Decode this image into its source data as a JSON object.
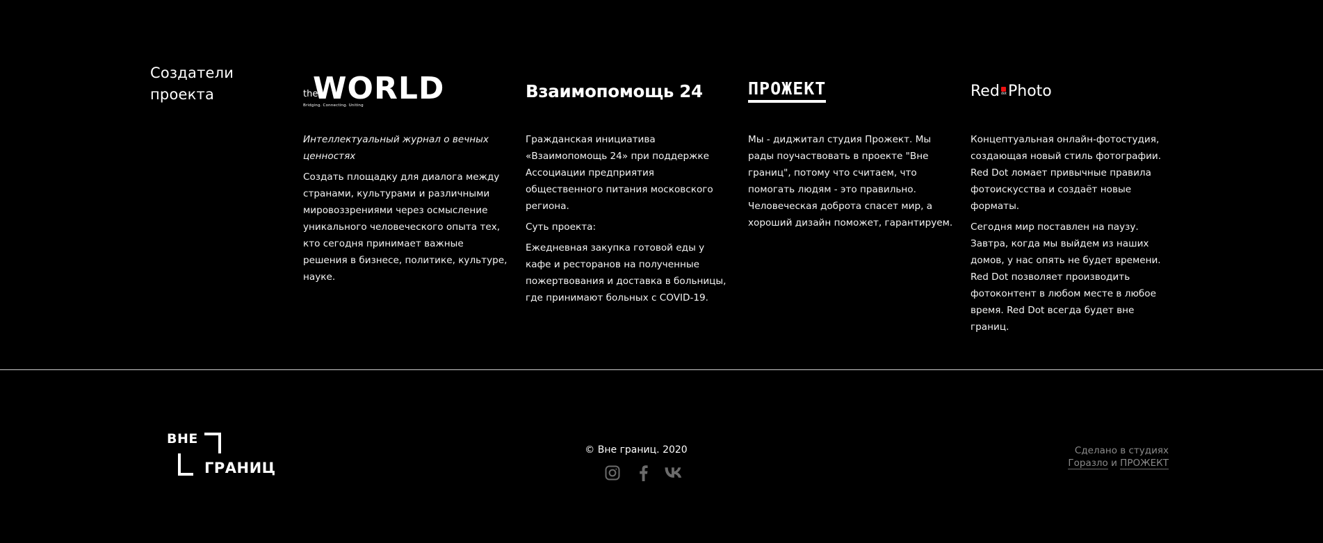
{
  "creators_title": "Создатели проекта",
  "partners": [
    {
      "logo": {
        "small": "the",
        "big": "WORLD",
        "tagline": "Bridging. Connecting. Uniting"
      },
      "paragraphs": [
        {
          "text": "Интеллектуальный журнал о вечных ценностях",
          "italic": true
        },
        {
          "text": "Создать площадку для диалога между странами, культурами и различными мировоззрениями через осмысление уникального человеческого опыта тех, кто сегодня принимает важные решения в бизнесе, политике, культуре, науке.",
          "italic": false
        }
      ]
    },
    {
      "logo": {
        "text": "Взаимопомощь 24"
      },
      "paragraphs": [
        {
          "text": "Гражданская инициатива «Взаимопомощь 24» при поддержке Ассоциации предприятия общественного питания московского региона.",
          "italic": false
        },
        {
          "text": "Суть проекта:",
          "italic": false
        },
        {
          "text": "Ежедневная закупка готовой еды у кафе и ресторанов на полученные пожертвования и доставка в больницы, где принимают больных с COVID-19.",
          "italic": false
        }
      ]
    },
    {
      "logo": {
        "text": "ПРОЖЕКТ"
      },
      "paragraphs": [
        {
          "text": "Мы - диджитал студия Прожект. Мы рады поучаствовать в проекте \"Вне границ\", потому что считаем, что помогать людям - это правильно. Человеческая доброта спасет мир, а хороший дизайн поможет, гарантируем.",
          "italic": false
        }
      ]
    },
    {
      "logo": {
        "left": "Red",
        "dot": "dot",
        "right": "Photo",
        "dot_color": "#e11111"
      },
      "paragraphs": [
        {
          "text": "Концептуальная онлайн-фотостудия, создающая новый стиль фотографии. Red Dot ломает привычные правила фотоискусства и создаёт новые форматы.",
          "italic": false
        },
        {
          "text": "Сегодня мир поставлен на паузу. Завтра, когда мы выйдем из наших домов, у нас опять не будет времени. Red Dot позволяет производить фотоконтент в любом месте в любое время. Red Dot всегда будет вне границ.",
          "italic": false
        }
      ]
    }
  ],
  "footer": {
    "brand": {
      "line1": "ВНЕ",
      "line2": "ГРАНИЦ"
    },
    "copyright": "© Вне границ. 2020",
    "socials": [
      {
        "name": "instagram",
        "icon": "instagram-icon"
      },
      {
        "name": "facebook",
        "icon": "facebook-icon"
      },
      {
        "name": "vk",
        "icon": "vk-icon"
      }
    ],
    "credits": {
      "line1": "Сделано в студиях",
      "studio1": "Горазло",
      "conj": "и",
      "studio2": "ПРОЖЕКТ"
    }
  },
  "colors": {
    "background": "#000000",
    "text": "#ffffff",
    "muted": "#8a8a8a",
    "accent": "#e11111"
  }
}
